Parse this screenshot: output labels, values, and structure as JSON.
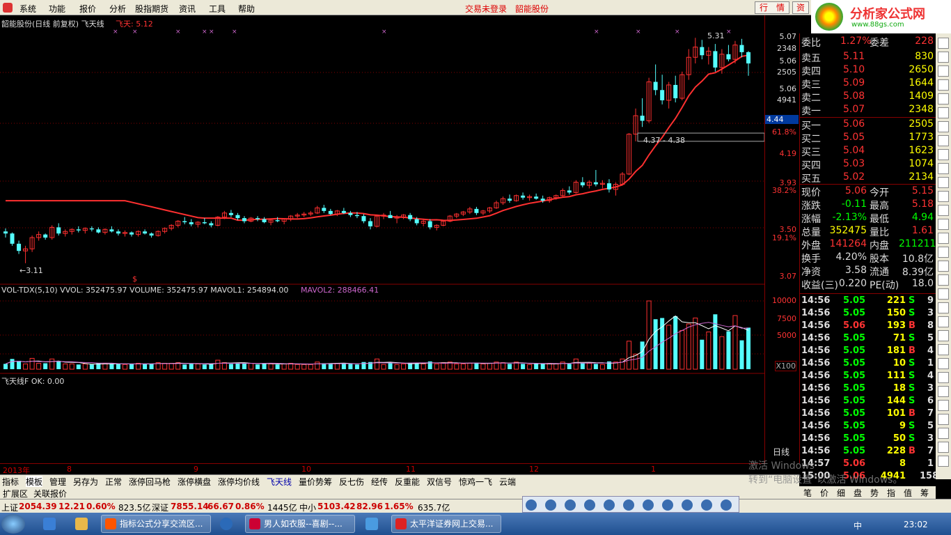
{
  "menu": {
    "items": [
      "系统",
      "功能",
      "报价",
      "分析",
      "股指期货",
      "资讯",
      "工具",
      "帮助"
    ],
    "status_login": "交易未登录",
    "status_stock": "韶能股份",
    "btn_quote": "行　情",
    "btn_trade": "资"
  },
  "logo": {
    "title": "分析家公式网",
    "url": "www.88gs.com"
  },
  "chart": {
    "title": "韶能股份(日线 前复权) 飞天线",
    "indicator": "飞天: 5.12",
    "high_label": "5.31",
    "low_label": "←3.11",
    "range_label": "4.37 - 4.38",
    "volume_header": "VOL-TDX(5,10)  VVOL: 352475.97  VOLUME: 352475.97  MAVOL1: 254894.00",
    "volume_mavol2": "MAVOL2: 288466.41",
    "sub_header": "飞天线F  OK: 0.00",
    "price_axis": [
      "5.07",
      "2348",
      "5.06",
      "2505",
      "5.06",
      "4941",
      "4.44",
      "61.8%",
      "4.19",
      "3.93",
      "38.2%",
      "3.50",
      "19.1%",
      "3.07"
    ],
    "volume_axis": [
      "10000",
      "7500",
      "5000",
      "X100"
    ],
    "time_axis": [
      "2013年",
      "8",
      "9",
      "10",
      "11",
      "12",
      "1"
    ],
    "accent_red": "#ff3030",
    "accent_cyan": "#55ffff"
  },
  "quote": {
    "header": {
      "label": "委比",
      "value": "1.27%",
      "label2": "委差",
      "value2": "228"
    },
    "sell": [
      {
        "label": "卖五",
        "price": "5.11",
        "vol": "830"
      },
      {
        "label": "卖四",
        "price": "5.10",
        "vol": "2650"
      },
      {
        "label": "卖三",
        "price": "5.09",
        "vol": "1644"
      },
      {
        "label": "卖二",
        "price": "5.08",
        "vol": "1409"
      },
      {
        "label": "卖一",
        "price": "5.07",
        "vol": "2348"
      }
    ],
    "buy": [
      {
        "label": "买一",
        "price": "5.06",
        "vol": "2505"
      },
      {
        "label": "买二",
        "price": "5.05",
        "vol": "1773"
      },
      {
        "label": "买三",
        "price": "5.04",
        "vol": "1623"
      },
      {
        "label": "买四",
        "price": "5.03",
        "vol": "1074"
      },
      {
        "label": "买五",
        "price": "5.02",
        "vol": "2134"
      }
    ],
    "stats": [
      {
        "l1": "现价",
        "v1": "5.06",
        "l2": "今开",
        "v2": "5.15"
      },
      {
        "l1": "涨跌",
        "v1": "-0.11",
        "l2": "最高",
        "v2": "5.18"
      },
      {
        "l1": "涨幅",
        "v1": "-2.13%",
        "l2": "最低",
        "v2": "4.94"
      },
      {
        "l1": "总量",
        "v1": "352475",
        "l2": "量比",
        "v2": "1.61"
      },
      {
        "l1": "外盘",
        "v1": "141264",
        "l2": "内盘",
        "v2": "211211"
      },
      {
        "l1": "换手",
        "v1": "4.20%",
        "l2": "股本",
        "v2": "10.8亿"
      },
      {
        "l1": "净资",
        "v1": "3.58",
        "l2": "流通",
        "v2": "8.39亿"
      },
      {
        "l1": "收益(三)",
        "v1": "0.220",
        "l2": "PE(动)",
        "v2": "18.0"
      }
    ],
    "ticks": [
      {
        "t": "14:56",
        "p": "5.05",
        "v": "221",
        "s": "S",
        "n": "9"
      },
      {
        "t": "14:56",
        "p": "5.05",
        "v": "150",
        "s": "S",
        "n": "3"
      },
      {
        "t": "14:56",
        "p": "5.06",
        "v": "193",
        "s": "B",
        "n": "8"
      },
      {
        "t": "14:56",
        "p": "5.05",
        "v": "71",
        "s": "S",
        "n": "5"
      },
      {
        "t": "14:56",
        "p": "5.05",
        "v": "181",
        "s": "B",
        "n": "4"
      },
      {
        "t": "14:56",
        "p": "5.05",
        "v": "10",
        "s": "S",
        "n": "1"
      },
      {
        "t": "14:56",
        "p": "5.05",
        "v": "111",
        "s": "S",
        "n": "4"
      },
      {
        "t": "14:56",
        "p": "5.05",
        "v": "18",
        "s": "S",
        "n": "3"
      },
      {
        "t": "14:56",
        "p": "5.05",
        "v": "144",
        "s": "S",
        "n": "6"
      },
      {
        "t": "14:56",
        "p": "5.05",
        "v": "101",
        "s": "B",
        "n": "7"
      },
      {
        "t": "14:56",
        "p": "5.05",
        "v": "9",
        "s": "S",
        "n": "5"
      },
      {
        "t": "14:56",
        "p": "5.05",
        "v": "50",
        "s": "S",
        "n": "3"
      },
      {
        "t": "14:56",
        "p": "5.05",
        "v": "228",
        "s": "B",
        "n": "7"
      },
      {
        "t": "14:57",
        "p": "5.06",
        "v": "8",
        "s": "",
        "n": "1"
      },
      {
        "t": "15:00",
        "p": "5.06",
        "v": "4941",
        "s": "",
        "n": "158"
      }
    ],
    "bottom_tabs": [
      "笔",
      "价",
      "细",
      "盘",
      "势",
      "指",
      "值",
      "筹"
    ]
  },
  "tabs": [
    "指标",
    "模板",
    "管理",
    "另存为",
    "正常",
    "涨停回马枪",
    "涨停横盘",
    "涨停均价线",
    "飞天线",
    "量价势筹",
    "反七伤",
    "经传",
    "反重能",
    "双信号",
    "惊鸡一飞",
    "云端"
  ],
  "tabs2": [
    "扩展区",
    "关联报价"
  ],
  "index_bar": {
    "sh": "上证",
    "sh_val": "2054.39",
    "sh_chg": "12.21",
    "sh_pct": "0.60%",
    "sh_amt": "823.5亿",
    "sz": "深证",
    "sz_val": "7855.14",
    "sz_chg": "66.67",
    "sz_pct": "0.86%",
    "sz_amt": "1445亿",
    "zx": "中小",
    "zx_val": "5103.42",
    "zx_chg": "82.96",
    "zx_pct": "1.65%",
    "zx_amt": "635.7亿"
  },
  "taskbar": {
    "tasks": [
      "指标公式分享交流区...",
      "男人如衣服--喜剧--...",
      "太平洋证券网上交易..."
    ],
    "lang": "中",
    "time": "23:02"
  },
  "watermark": {
    "line1": "激活 Windows",
    "line2": "转到“电脑设置”以激活 Windows。",
    "day": "日线"
  },
  "candles": [
    [
      3.42,
      3.45,
      3.36,
      3.4
    ],
    [
      3.4,
      3.41,
      3.28,
      3.3
    ],
    [
      3.3,
      3.33,
      3.2,
      3.23
    ],
    [
      3.23,
      3.28,
      3.11,
      3.25
    ],
    [
      3.25,
      3.38,
      3.22,
      3.36
    ],
    [
      3.36,
      3.42,
      3.33,
      3.39
    ],
    [
      3.39,
      3.4,
      3.34,
      3.36
    ],
    [
      3.36,
      3.48,
      3.34,
      3.46
    ],
    [
      3.46,
      3.5,
      3.38,
      3.4
    ],
    [
      3.4,
      3.44,
      3.37,
      3.42
    ],
    [
      3.42,
      3.45,
      3.39,
      3.44
    ],
    [
      3.44,
      3.47,
      3.41,
      3.43
    ],
    [
      3.43,
      3.46,
      3.4,
      3.45
    ],
    [
      3.45,
      3.47,
      3.42,
      3.44
    ],
    [
      3.44,
      3.46,
      3.4,
      3.41
    ],
    [
      3.41,
      3.45,
      3.39,
      3.44
    ],
    [
      3.44,
      3.47,
      3.41,
      3.42
    ],
    [
      3.42,
      3.44,
      3.38,
      3.4
    ],
    [
      3.4,
      3.43,
      3.37,
      3.41
    ],
    [
      3.41,
      3.42,
      3.37,
      3.39
    ],
    [
      3.39,
      3.43,
      3.37,
      3.42
    ],
    [
      3.42,
      3.44,
      3.39,
      3.4
    ],
    [
      3.4,
      3.41,
      3.36,
      3.38
    ],
    [
      3.38,
      3.43,
      3.37,
      3.42
    ],
    [
      3.42,
      3.46,
      3.4,
      3.45
    ],
    [
      3.45,
      3.49,
      3.43,
      3.48
    ],
    [
      3.48,
      3.53,
      3.46,
      3.52
    ],
    [
      3.52,
      3.56,
      3.49,
      3.51
    ],
    [
      3.51,
      3.54,
      3.47,
      3.49
    ],
    [
      3.49,
      3.52,
      3.46,
      3.51
    ],
    [
      3.51,
      3.55,
      3.49,
      3.5
    ],
    [
      3.5,
      3.52,
      3.46,
      3.48
    ],
    [
      3.48,
      3.57,
      3.47,
      3.56
    ],
    [
      3.56,
      3.62,
      3.54,
      3.6
    ],
    [
      3.6,
      3.63,
      3.56,
      3.58
    ],
    [
      3.58,
      3.6,
      3.53,
      3.55
    ],
    [
      3.55,
      3.57,
      3.5,
      3.52
    ],
    [
      3.52,
      3.56,
      3.51,
      3.55
    ],
    [
      3.55,
      3.57,
      3.52,
      3.54
    ],
    [
      3.54,
      3.56,
      3.5,
      3.51
    ],
    [
      3.51,
      3.54,
      3.48,
      3.53
    ],
    [
      3.53,
      3.56,
      3.51,
      3.52
    ],
    [
      3.52,
      3.55,
      3.49,
      3.54
    ],
    [
      3.54,
      3.58,
      3.52,
      3.57
    ],
    [
      3.57,
      3.6,
      3.55,
      3.58
    ],
    [
      3.58,
      3.61,
      3.56,
      3.59
    ],
    [
      3.59,
      3.62,
      3.57,
      3.6
    ],
    [
      3.6,
      3.67,
      3.59,
      3.65
    ],
    [
      3.65,
      3.68,
      3.6,
      3.62
    ],
    [
      3.62,
      3.64,
      3.58,
      3.59
    ],
    [
      3.59,
      3.63,
      3.57,
      3.62
    ],
    [
      3.62,
      3.65,
      3.59,
      3.6
    ],
    [
      3.6,
      3.62,
      3.56,
      3.58
    ],
    [
      3.58,
      3.61,
      3.55,
      3.57
    ],
    [
      3.57,
      3.59,
      3.5,
      3.52
    ],
    [
      3.52,
      3.55,
      3.44,
      3.47
    ],
    [
      3.47,
      3.58,
      3.46,
      3.57
    ],
    [
      3.57,
      3.6,
      3.54,
      3.58
    ],
    [
      3.58,
      3.62,
      3.56,
      3.55
    ],
    [
      3.55,
      3.58,
      3.5,
      3.56
    ],
    [
      3.56,
      3.59,
      3.54,
      3.58
    ],
    [
      3.58,
      3.6,
      3.52,
      3.54
    ],
    [
      3.54,
      3.56,
      3.48,
      3.5
    ],
    [
      3.5,
      3.54,
      3.47,
      3.52
    ],
    [
      3.52,
      3.54,
      3.44,
      3.46
    ],
    [
      3.46,
      3.49,
      3.43,
      3.48
    ],
    [
      3.48,
      3.53,
      3.47,
      3.52
    ],
    [
      3.52,
      3.58,
      3.51,
      3.57
    ],
    [
      3.57,
      3.6,
      3.55,
      3.59
    ],
    [
      3.59,
      3.62,
      3.57,
      3.61
    ],
    [
      3.61,
      3.66,
      3.59,
      3.64
    ],
    [
      3.64,
      3.66,
      3.58,
      3.6
    ],
    [
      3.6,
      3.63,
      3.58,
      3.62
    ],
    [
      3.62,
      3.66,
      3.6,
      3.65
    ],
    [
      3.65,
      3.72,
      3.64,
      3.7
    ],
    [
      3.7,
      3.76,
      3.68,
      3.74
    ],
    [
      3.74,
      3.78,
      3.7,
      3.72
    ],
    [
      3.72,
      3.78,
      3.71,
      3.77
    ],
    [
      3.77,
      3.8,
      3.73,
      3.75
    ],
    [
      3.75,
      3.78,
      3.72,
      3.76
    ],
    [
      3.76,
      3.79,
      3.73,
      3.74
    ],
    [
      3.74,
      3.77,
      3.7,
      3.72
    ],
    [
      3.72,
      3.76,
      3.7,
      3.75
    ],
    [
      3.75,
      3.78,
      3.73,
      3.77
    ],
    [
      3.77,
      3.84,
      3.76,
      3.82
    ],
    [
      3.82,
      3.86,
      3.78,
      3.8
    ],
    [
      3.8,
      3.92,
      3.79,
      3.9
    ],
    [
      3.9,
      3.95,
      3.85,
      3.87
    ],
    [
      3.87,
      3.92,
      3.84,
      3.9
    ],
    [
      3.9,
      4.02,
      3.86,
      3.88
    ],
    [
      3.88,
      3.92,
      3.84,
      3.89
    ],
    [
      3.89,
      3.93,
      3.8,
      3.83
    ],
    [
      3.83,
      3.9,
      3.77,
      3.88
    ],
    [
      3.88,
      4.0,
      3.87,
      3.98
    ],
    [
      3.98,
      4.38,
      3.97,
      4.37
    ],
    [
      4.37,
      4.62,
      4.3,
      4.55
    ],
    [
      4.55,
      4.72,
      4.44,
      4.5
    ],
    [
      4.5,
      4.92,
      4.48,
      4.88
    ],
    [
      4.88,
      5.05,
      4.75,
      4.8
    ],
    [
      4.8,
      4.95,
      4.66,
      4.7
    ],
    [
      4.7,
      4.88,
      4.62,
      4.85
    ],
    [
      4.85,
      4.94,
      4.68,
      4.72
    ],
    [
      4.72,
      4.98,
      4.7,
      4.95
    ],
    [
      4.95,
      5.2,
      4.9,
      5.12
    ],
    [
      5.12,
      5.31,
      5.06,
      5.22
    ],
    [
      5.22,
      5.29,
      5.1,
      5.14
    ],
    [
      5.14,
      5.22,
      5.05,
      5.18
    ],
    [
      5.18,
      5.25,
      4.98,
      5.02
    ],
    [
      5.02,
      5.2,
      4.96,
      5.15
    ],
    [
      5.15,
      5.24,
      5.08,
      5.1
    ],
    [
      5.1,
      5.28,
      5.06,
      5.24
    ],
    [
      5.24,
      5.3,
      5.12,
      5.17
    ],
    [
      5.17,
      5.18,
      4.94,
      5.06
    ]
  ]
}
